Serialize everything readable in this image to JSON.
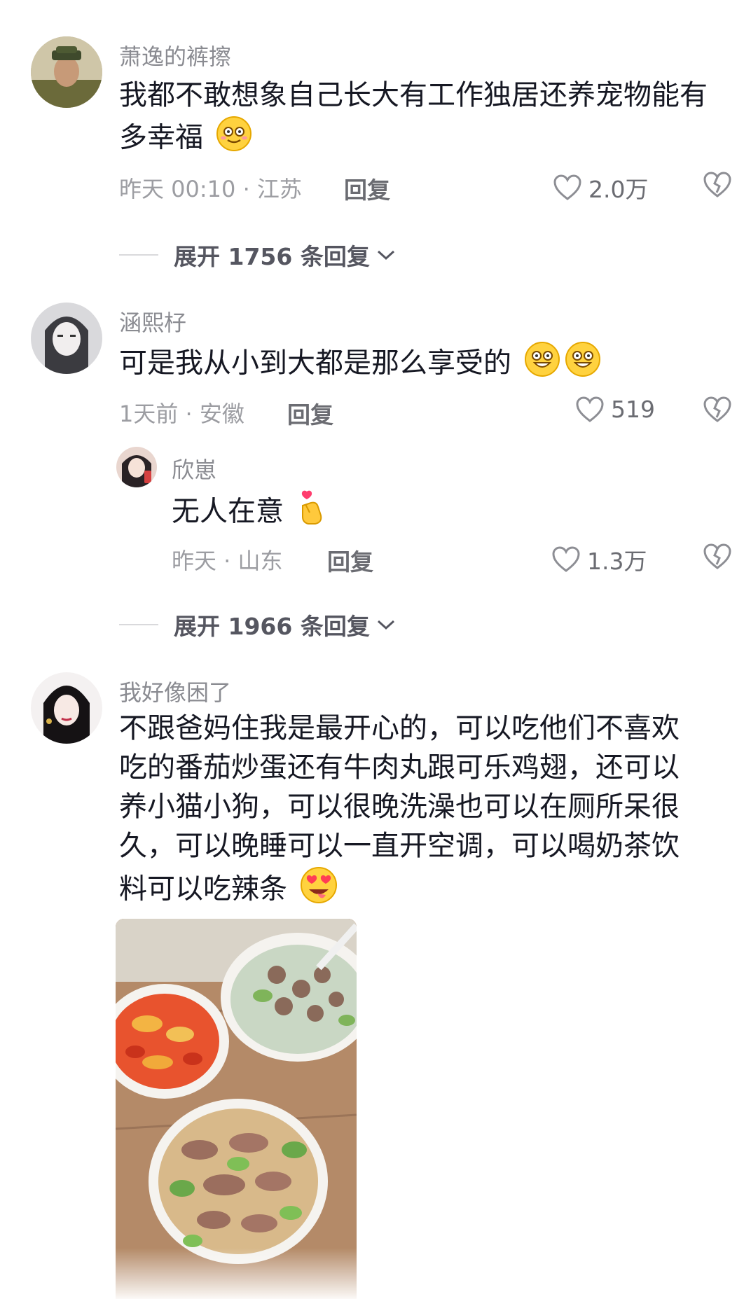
{
  "comments": [
    {
      "username": "萧逸的裤擦",
      "text": "我都不敢想象自己长大有工作独居还养宠物能有多幸福",
      "time_location": "昨天 00:10 · 江苏",
      "reply_label": "回复",
      "likes": "2.0万",
      "expand_label": "展开 1756 条回复"
    },
    {
      "username": "涵熙杍",
      "text": "可是我从小到大都是那么享受的",
      "time_location": "1天前 · 安徽",
      "reply_label": "回复",
      "likes": "519"
    },
    {
      "username": "欣崽",
      "text": "无人在意",
      "time_location": "昨天 · 山东",
      "reply_label": "回复",
      "likes": "1.3万",
      "expand_label": "展开 1966 条回复"
    },
    {
      "username": "我好像困了",
      "text_lines": [
        "不跟爸妈住我是最开心的，可以吃他们不喜欢",
        "吃的番茄炒蛋还有牛肉丸跟可乐鸡翅，还可以",
        "养小猫小狗，可以很晚洗澡也可以在厕所呆很",
        "久，可以晚睡可以一直开空调，可以喝奶茶饮",
        "料可以吃辣条"
      ]
    }
  ],
  "colors": {
    "text": "#161823",
    "meta": "#9c9da2",
    "action": "#6b6c72"
  },
  "icons": [
    "heart-icon",
    "broken-heart-icon",
    "chevron-down-icon",
    "smile-emoji",
    "heart-eyes-emoji",
    "finger-heart-emoji"
  ]
}
